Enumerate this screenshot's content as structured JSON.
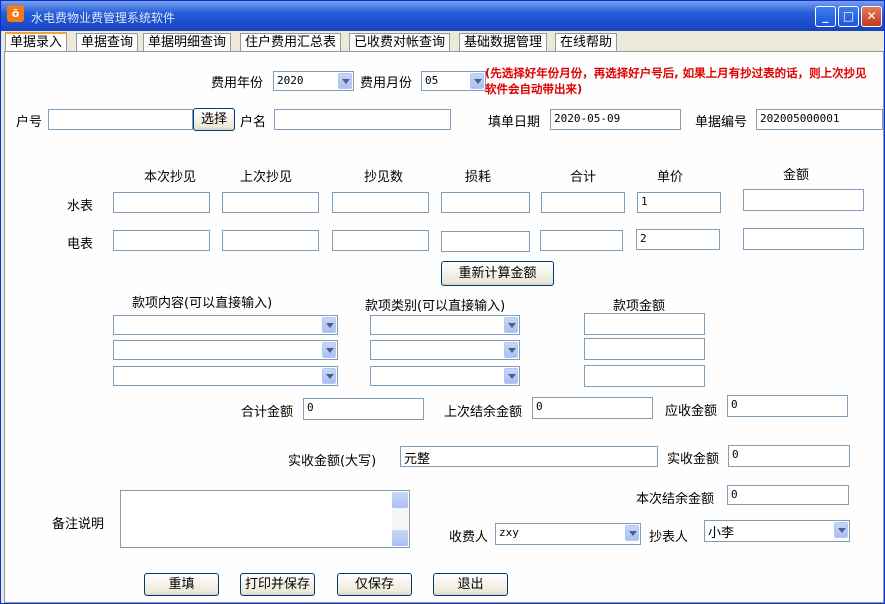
{
  "window": {
    "title": "水电费物业费管理系统软件",
    "app_icon": "app-icon"
  },
  "tabs": [
    {
      "label": "单据录入",
      "active": true
    },
    {
      "label": "单据查询"
    },
    {
      "label": "单据明细查询"
    },
    {
      "label": "住户费用汇总表"
    },
    {
      "label": "已收费对帐查询"
    },
    {
      "label": "基础数据管理"
    },
    {
      "label": "在线帮助"
    }
  ],
  "form": {
    "year_label": "费用年份",
    "year_value": "2020",
    "month_label": "费用月份",
    "month_value": "05",
    "notice_line1": "(先选择好年份月份，再选择好户号后, 如果上月有抄过表的话，则上次抄见",
    "notice_line2": "软件会自动带出来)",
    "account_label": "户号",
    "account_value": "",
    "select_button": "选择",
    "name_label": "户名",
    "name_value": "",
    "date_label": "填单日期",
    "date_value": "2020-05-09",
    "doc_no_label": "单据编号",
    "doc_no_value": "202005000001"
  },
  "meter": {
    "headers": [
      "本次抄见",
      "上次抄见",
      "抄见数",
      "损耗",
      "合计",
      "单价",
      "金额"
    ],
    "water": {
      "label": "水表",
      "current": "",
      "previous": "",
      "reading": "",
      "loss": "",
      "total": "",
      "unit_price": "1",
      "amount": ""
    },
    "electric": {
      "label": "电表",
      "current": "",
      "previous": "",
      "reading": "",
      "loss": "",
      "total": "",
      "unit_price": "2",
      "amount": ""
    },
    "recalc_button": "重新计算金额"
  },
  "items": {
    "content_header": "款项内容(可以直接输入)",
    "type_header": "款项类别(可以直接输入)",
    "amount_header": "款项金额"
  },
  "totals": {
    "total_label": "合计金额",
    "total_value": "0",
    "prev_balance_label": "上次结余金额",
    "prev_balance_value": "0",
    "receivable_label": "应收金额",
    "receivable_value": "0",
    "actual_upper_label": "实收金额(大写)",
    "actual_upper_value": "元整",
    "actual_label": "实收金额",
    "actual_value": "0",
    "balance_label": "本次结余金额",
    "balance_value": "0"
  },
  "notes": {
    "label": "备注说明",
    "value": ""
  },
  "people": {
    "collector_label": "收费人",
    "collector_value": "zxy",
    "reader_label": "抄表人",
    "reader_value": "小李"
  },
  "actions": {
    "reset": "重填",
    "print_save": "打印并保存",
    "save_only": "仅保存",
    "exit": "退出"
  }
}
